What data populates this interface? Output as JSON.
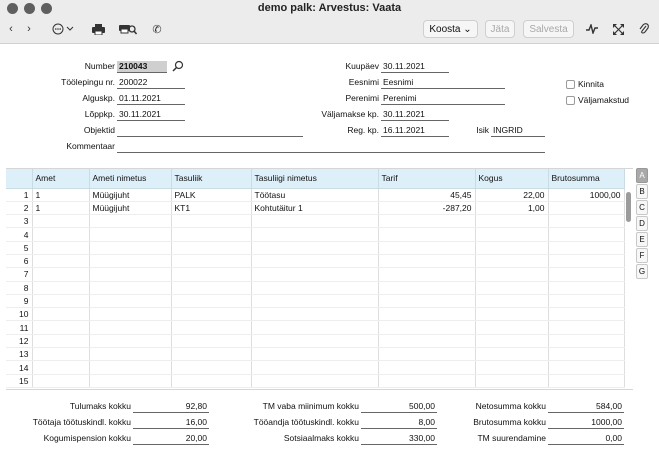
{
  "window": {
    "title": "demo palk: Arvestus: Vaata"
  },
  "toolbar": {
    "koosta": "Koosta ⌄",
    "jata": "Jäta",
    "salvesta": "Salvesta"
  },
  "form": {
    "number_label": "Number",
    "number": "210043",
    "toolepingu_label": "Töölepingu nr.",
    "toolepingu": "200022",
    "alguskp_label": "Alguskp.",
    "alguskp": "01.11.2021",
    "loppkp_label": "Lõppkp.",
    "loppkp": "30.11.2021",
    "objektid_label": "Objektid",
    "objektid": "",
    "kommentaar_label": "Kommentaar",
    "kommentaar": "",
    "kuupaev_label": "Kuupäev",
    "kuupaev": "30.11.2021",
    "eesnimi_label": "Eesnimi",
    "eesnimi": "Eesnimi",
    "perenimi_label": "Perenimi",
    "perenimi": "Perenimi",
    "valjamakse_label": "Väljamakse kp.",
    "valjamakse": "30.11.2021",
    "regkp_label": "Reg. kp.",
    "regkp": "16.11.2021",
    "isik_label": "Isik",
    "isik": "INGRID",
    "kinnita_label": "Kinnita",
    "valjamakstud_label": "Väljamakstud"
  },
  "grid": {
    "headers": [
      "",
      "Amet",
      "Ameti nimetus",
      "Tasuliik",
      "Tasuliigi nimetus",
      "Tarif",
      "Kogus",
      "Brutosumma"
    ],
    "rows": [
      [
        "1",
        "1",
        "Müügijuht",
        "PALK",
        "Töötasu",
        "45,45",
        "22,00",
        "1000,00"
      ],
      [
        "2",
        "1",
        "Müügijuht",
        "KT1",
        "Kohtutäitur 1",
        "-287,20",
        "1,00",
        ""
      ],
      [
        "3",
        "",
        "",
        "",
        "",
        "",
        "",
        ""
      ],
      [
        "4",
        "",
        "",
        "",
        "",
        "",
        "",
        ""
      ],
      [
        "5",
        "",
        "",
        "",
        "",
        "",
        "",
        ""
      ],
      [
        "6",
        "",
        "",
        "",
        "",
        "",
        "",
        ""
      ],
      [
        "7",
        "",
        "",
        "",
        "",
        "",
        "",
        ""
      ],
      [
        "8",
        "",
        "",
        "",
        "",
        "",
        "",
        ""
      ],
      [
        "9",
        "",
        "",
        "",
        "",
        "",
        "",
        ""
      ],
      [
        "10",
        "",
        "",
        "",
        "",
        "",
        "",
        ""
      ],
      [
        "11",
        "",
        "",
        "",
        "",
        "",
        "",
        ""
      ],
      [
        "12",
        "",
        "",
        "",
        "",
        "",
        "",
        ""
      ],
      [
        "13",
        "",
        "",
        "",
        "",
        "",
        "",
        ""
      ],
      [
        "14",
        "",
        "",
        "",
        "",
        "",
        "",
        ""
      ],
      [
        "15",
        "",
        "",
        "",
        "",
        "",
        "",
        ""
      ]
    ],
    "tabs": [
      "A",
      "B",
      "C",
      "D",
      "E",
      "F",
      "G"
    ]
  },
  "totals": {
    "tulumaks_label": "Tulumaks kokku",
    "tulumaks": "92,80",
    "tootaja_label": "Töötaja töötuskindl. kokku",
    "tootaja": "16,00",
    "kogumis_label": "Kogumispension kokku",
    "kogumis": "20,00",
    "tmvaba_label": "TM vaba miinimum kokku",
    "tmvaba": "500,00",
    "tooandja_label": "Tööandja töötuskindl. kokku",
    "tooandja": "8,00",
    "sots_label": "Sotsiaalmaks kokku",
    "sots": "330,00",
    "neto_label": "Netosumma kokku",
    "neto": "584,00",
    "bruto_label": "Brutosumma kokku",
    "bruto": "1000,00",
    "tmsuur_label": "TM suurendamine",
    "tmsuur": "0,00"
  }
}
